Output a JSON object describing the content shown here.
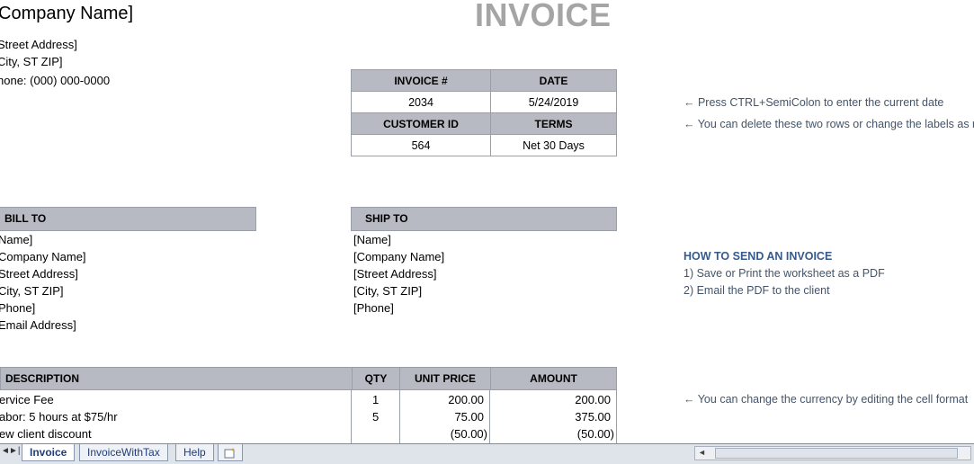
{
  "company": {
    "name": "Company Name]",
    "street": "Street Address]",
    "city": "City, ST  ZIP]",
    "phone": "hone: (000) 000-0000"
  },
  "title": "INVOICE",
  "meta": {
    "invoice_no_label": "INVOICE #",
    "date_label": "DATE",
    "invoice_no": "2034",
    "date": "5/24/2019",
    "customer_id_label": "CUSTOMER ID",
    "terms_label": "TERMS",
    "customer_id": "564",
    "terms": "Net 30 Days"
  },
  "notes": {
    "date_tip": "← Press CTRL+SemiColon to enter the current date",
    "rows_tip": "← You can delete these two rows or change the labels as n",
    "how_title": "HOW TO SEND AN INVOICE",
    "how_1": "1) Save or Print the worksheet as a PDF",
    "how_2": "2) Email the PDF to the client",
    "currency_tip": "← You can change the currency by editing the cell format"
  },
  "bill_to": {
    "label": "BILL TO",
    "lines": [
      "Name]",
      "Company Name]",
      "Street Address]",
      "City, ST  ZIP]",
      "Phone]",
      "Email Address]"
    ]
  },
  "ship_to": {
    "label": "SHIP TO",
    "lines": [
      "[Name]",
      "[Company Name]",
      "[Street Address]",
      "[City, ST  ZIP]",
      "[Phone]"
    ]
  },
  "items": {
    "headers": {
      "description": "DESCRIPTION",
      "qty": "QTY",
      "unit_price": "UNIT PRICE",
      "amount": "AMOUNT"
    },
    "rows": [
      {
        "description": "ervice Fee",
        "qty": "1",
        "unit_price": "200.00 ",
        "amount": "200.00 "
      },
      {
        "description": "abor: 5 hours at $75/hr",
        "qty": "5",
        "unit_price": "75.00 ",
        "amount": "375.00 "
      },
      {
        "description": "ew client discount",
        "qty": "",
        "unit_price": "(50.00)",
        "amount": "(50.00)"
      }
    ]
  },
  "sheet_tabs": {
    "nav_prev": "◄",
    "nav_last": "►|",
    "tabs": [
      "Invoice",
      "InvoiceWithTax",
      "Help"
    ],
    "active": "Invoice",
    "new_sheet_icon": "insert-sheet-icon"
  }
}
